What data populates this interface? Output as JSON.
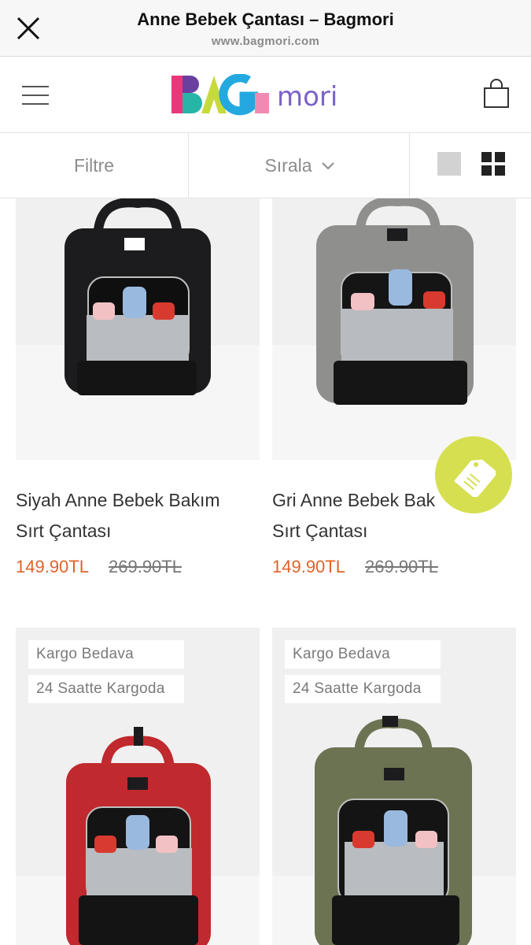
{
  "browser": {
    "title": "Anne Bebek Çantası – Bagmori",
    "url": "www.bagmori.com"
  },
  "header": {
    "logo_text_colored": "BAG",
    "logo_text_plain": "mori"
  },
  "toolbar": {
    "filter_label": "Filtre",
    "sort_label": "Sırala"
  },
  "products": [
    {
      "name_line1": "Siyah Anne Bebek Bakım",
      "name_line2": "Sırt Çantası",
      "price": "149.90TL",
      "old_price": "269.90TL",
      "color": "#1c1c1e"
    },
    {
      "name_line1": "Gri Anne Bebek Bakım",
      "name_line2": "Sırt Çantası",
      "price": "149.90TL",
      "old_price": "269.90TL",
      "color": "#8f8f8d"
    },
    {
      "badge1": "Kargo Bedava",
      "badge2": "24 Saatte Kargoda",
      "color": "#c0292d"
    },
    {
      "badge1": "Kargo Bedava",
      "badge2": "24 Saatte Kargoda",
      "color": "#6c7353"
    }
  ],
  "colors": {
    "price": "#e0622a",
    "fab": "#d6df50"
  }
}
